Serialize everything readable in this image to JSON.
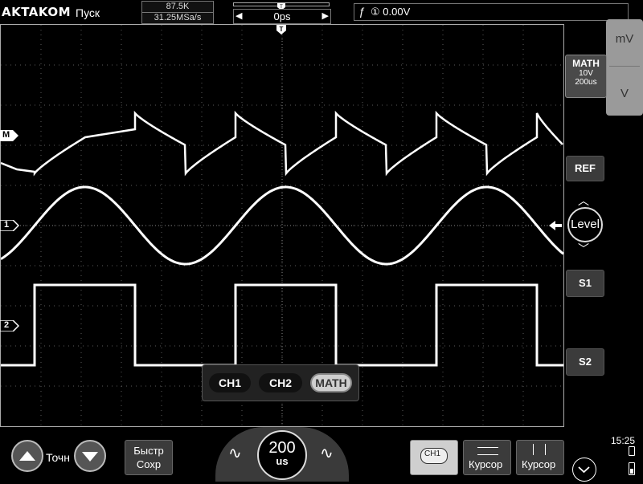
{
  "header": {
    "brand": "AKTAKOM",
    "run_status": "Пуск",
    "memory_depth": "87.5K",
    "sample_rate": "31.25MSa/s",
    "trigger_position": "0ps",
    "trigger_source_level": "① 0.00V"
  },
  "waveform_labels": {
    "math_marker": "M",
    "ch1_marker": "1",
    "ch2_marker": "2",
    "trigger_marker": "T"
  },
  "right_panel": {
    "volts_up": "mV",
    "volts_down": "V",
    "math_title": "MATH",
    "math_scale": "10V",
    "math_timebase": "200us",
    "ref_label": "REF",
    "level_label": "Level",
    "s1_label": "S1",
    "s2_label": "S2"
  },
  "channel_popup": {
    "ch1": "CH1",
    "ch2": "CH2",
    "math": "MATH"
  },
  "bottom": {
    "fine_label": "Точн",
    "quick_save_line1": "Быстр",
    "quick_save_line2": "Сохр",
    "timebase_value": "200",
    "timebase_unit": "us",
    "ch1_tab": "CH1",
    "cursor_h_label": "Курсор",
    "cursor_v_label": "Курсор",
    "clock": "15:25"
  },
  "colors": {
    "trace": "#ffffff",
    "grid": "#5a5a5a",
    "panel_bg": "#3b3b3b",
    "active_pill": "#cfcfcf"
  }
}
